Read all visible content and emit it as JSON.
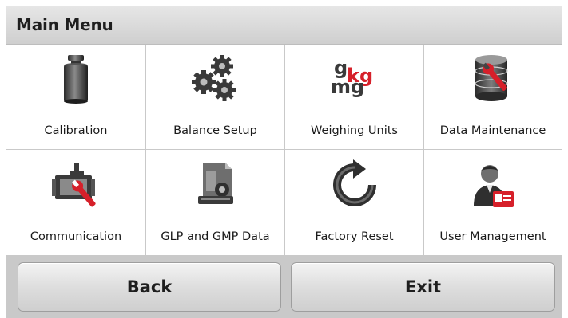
{
  "header": {
    "title": "Main Menu"
  },
  "menu": {
    "items": [
      {
        "label": "Calibration",
        "icon": "calibration-weight-icon"
      },
      {
        "label": "Balance Setup",
        "icon": "gears-icon"
      },
      {
        "label": "Weighing Units",
        "icon": "weighing-units-icon",
        "icon_text": {
          "g": "g",
          "kg": "kg",
          "mg": "mg"
        }
      },
      {
        "label": "Data Maintenance",
        "icon": "database-wrench-icon"
      },
      {
        "label": "Communication",
        "icon": "communication-wrench-icon"
      },
      {
        "label": "GLP and GMP Data",
        "icon": "document-icon"
      },
      {
        "label": "Factory Reset",
        "icon": "reset-arrow-icon"
      },
      {
        "label": "User Management",
        "icon": "user-badge-icon"
      }
    ]
  },
  "footer": {
    "back_label": "Back",
    "exit_label": "Exit"
  },
  "colors": {
    "accent_red": "#d6202a",
    "titlebar": "#d9d9d9",
    "footer_bg": "#c9c9c9"
  }
}
